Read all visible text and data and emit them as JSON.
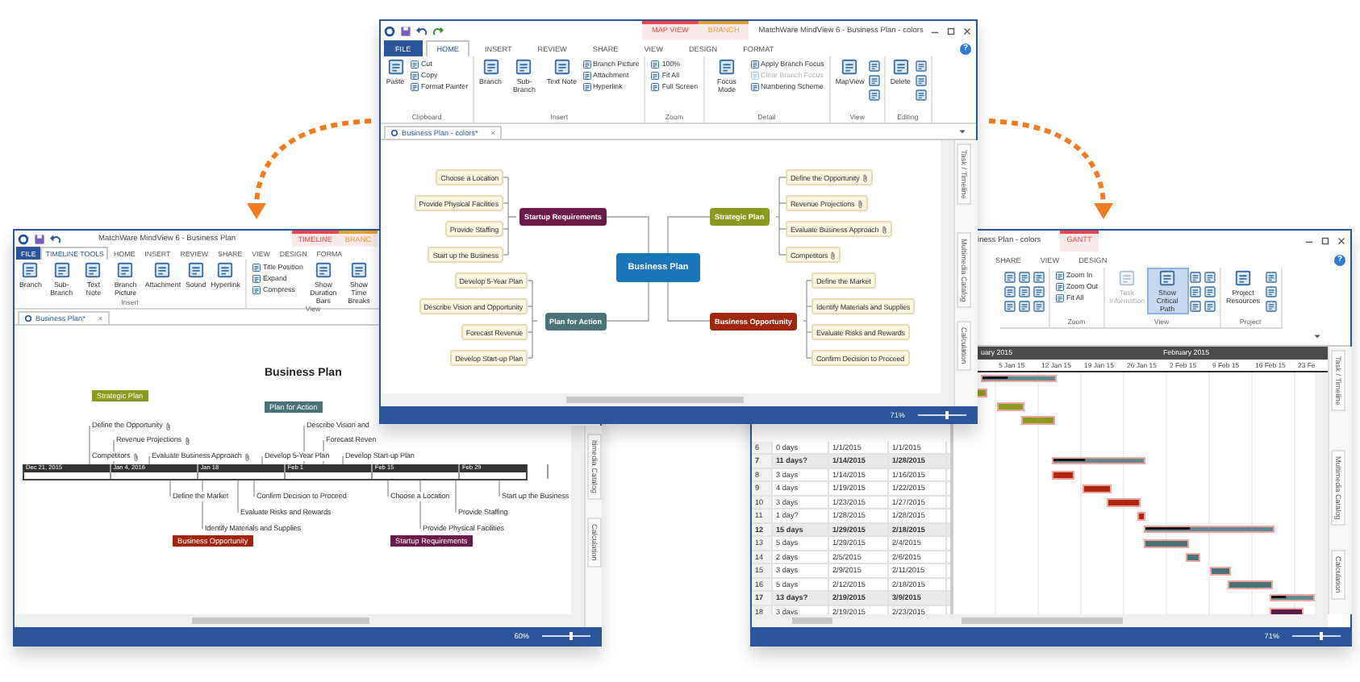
{
  "center_window": {
    "title": "MatchWare MindView 6 - Business Plan - colors",
    "context_tabs": [
      {
        "label": "MAP VIEW",
        "color": "#e8474c"
      },
      {
        "label": "BRANCH",
        "color": "#e0a030"
      }
    ],
    "tabs": [
      {
        "kind": "file",
        "label": "FILE",
        "selected": false
      },
      {
        "kind": "tab",
        "label": "HOME",
        "selected": true
      },
      {
        "kind": "tab",
        "label": "INSERT",
        "selected": false
      },
      {
        "kind": "tab",
        "label": "REVIEW",
        "selected": false
      },
      {
        "kind": "tab",
        "label": "SHARE",
        "selected": false
      },
      {
        "kind": "tab",
        "label": "VIEW",
        "selected": false
      },
      {
        "kind": "tab",
        "label": "DESIGN",
        "selected": false
      },
      {
        "kind": "tab",
        "label": "FORMAT",
        "selected": false
      }
    ],
    "help": "?",
    "ribbon": [
      {
        "label": "Clipboard",
        "items": [
          {
            "kind": "large",
            "label": "Paste",
            "disabled": false
          },
          {
            "kind": "small",
            "label": "Cut",
            "disabled": false
          },
          {
            "kind": "small",
            "label": "Copy",
            "disabled": false
          },
          {
            "kind": "small",
            "label": "Format Painter",
            "disabled": false
          }
        ]
      },
      {
        "label": "Insert",
        "items": [
          {
            "kind": "large",
            "label": "Branch",
            "disabled": false
          },
          {
            "kind": "large",
            "label": "Sub-Branch",
            "disabled": false
          },
          {
            "kind": "large",
            "label": "Text Note",
            "disabled": false
          },
          {
            "kind": "small",
            "label": "Branch Picture",
            "disabled": false
          },
          {
            "kind": "small",
            "label": "Attachment",
            "disabled": false
          },
          {
            "kind": "small",
            "label": "Hyperlink",
            "disabled": false
          }
        ]
      },
      {
        "label": "Zoom",
        "items": [
          {
            "kind": "small",
            "label": "100%",
            "disabled": false
          },
          {
            "kind": "small",
            "label": "Fit All",
            "disabled": false
          },
          {
            "kind": "small",
            "label": "Full Screen",
            "disabled": false
          }
        ]
      },
      {
        "label": "Detail",
        "items": [
          {
            "kind": "large",
            "label": "Focus Mode",
            "disabled": false
          },
          {
            "kind": "small",
            "label": "Apply Branch Focus",
            "disabled": false
          },
          {
            "kind": "small",
            "label": "Clear Branch Focus",
            "disabled": true
          },
          {
            "kind": "small",
            "label": "Numbering Scheme",
            "disabled": false
          }
        ]
      },
      {
        "label": "View",
        "items": [
          {
            "kind": "large",
            "label": "MapView",
            "disabled": false
          },
          {
            "kind": "icon",
            "disabled": false
          },
          {
            "kind": "icon",
            "disabled": false
          },
          {
            "kind": "icon",
            "disabled": false
          }
        ]
      },
      {
        "label": "Editing",
        "items": [
          {
            "kind": "large",
            "label": "Delete",
            "disabled": false
          },
          {
            "kind": "icon",
            "disabled": false
          },
          {
            "kind": "icon",
            "disabled": false
          },
          {
            "kind": "icon",
            "disabled": false
          }
        ]
      }
    ],
    "doc_tab": {
      "label": "Business Plan - colors*",
      "close": "×"
    },
    "mindmap": {
      "center": "Business Plan",
      "branches": [
        {
          "label": "Startup Requirements",
          "color": "#6b1a4a",
          "children": [
            {
              "label": "Choose a Location",
              "attachment": false
            },
            {
              "label": "Provide Physical Facilities",
              "attachment": false
            },
            {
              "label": "Provide Staffing",
              "attachment": false
            },
            {
              "label": "Start up the Business",
              "attachment": false
            }
          ]
        },
        {
          "label": "Strategic Plan",
          "color": "#8a9a1e",
          "children": [
            {
              "label": "Define the Opportunity",
              "attachment": true
            },
            {
              "label": "Revenue Projections",
              "attachment": true
            },
            {
              "label": "Evaluate Business Approach",
              "attachment": true
            },
            {
              "label": "Competitors",
              "attachment": true
            }
          ]
        },
        {
          "label": "Plan for Action",
          "color": "#4a7378",
          "children": [
            {
              "label": "Develop 5-Year  Plan",
              "attachment": false
            },
            {
              "label": "Describe Vision and Opportunity",
              "attachment": false
            },
            {
              "label": "Forecast Revenue",
              "attachment": false
            },
            {
              "label": "Develop Start-up Plan",
              "attachment": false
            }
          ]
        },
        {
          "label": "Business Opportunity",
          "color": "#a2260e",
          "children": [
            {
              "label": "Define the Market",
              "attachment": false
            },
            {
              "label": "Identify Materials and Supplies",
              "attachment": false
            },
            {
              "label": "Evaluate Risks and Rewards",
              "attachment": false
            },
            {
              "label": "Confirm Decision to Proceed",
              "attachment": false
            }
          ]
        }
      ]
    },
    "side_tabs": [
      "Task / Timeline",
      "Multimedia Catalog",
      "Calculation"
    ],
    "status": {
      "zoom": "71%",
      "level": 0.55
    }
  },
  "left_window": {
    "title": "MatchWare MindView 6 - Business Plan",
    "context_tabs": [
      {
        "label": "TIMELINE",
        "color": "#e8474c"
      },
      {
        "label": "BRANC",
        "color": "#e0a030"
      }
    ],
    "tabs": [
      {
        "kind": "file",
        "label": "FILE",
        "selected": false
      },
      {
        "kind": "tab",
        "label": "TIMELINE TOOLS",
        "selected": true
      },
      {
        "kind": "tab",
        "label": "HOME",
        "selected": false
      },
      {
        "kind": "tab",
        "label": "INSERT",
        "selected": false
      },
      {
        "kind": "tab",
        "label": "REVIEW",
        "selected": false
      },
      {
        "kind": "tab",
        "label": "SHARE",
        "selected": false
      },
      {
        "kind": "tab",
        "label": "VIEW",
        "selected": false
      },
      {
        "kind": "tab",
        "label": "DESIGN",
        "selected": false
      },
      {
        "kind": "tab",
        "label": "FORMA",
        "selected": false
      }
    ],
    "ribbon": [
      {
        "label": "Insert",
        "items": [
          {
            "kind": "large",
            "label": "Branch"
          },
          {
            "kind": "large",
            "label": "Sub-Branch"
          },
          {
            "kind": "large",
            "label": "Text Note"
          },
          {
            "kind": "large",
            "label": "Branch Picture"
          },
          {
            "kind": "large",
            "label": "Attachment"
          },
          {
            "kind": "large",
            "label": "Sound"
          },
          {
            "kind": "large",
            "label": "Hyperlink"
          }
        ]
      },
      {
        "label": "View",
        "items": [
          {
            "kind": "small",
            "label": "Title Position"
          },
          {
            "kind": "small",
            "label": "Expand"
          },
          {
            "kind": "small",
            "label": "Compress"
          },
          {
            "kind": "large",
            "label": "Show Duration Bars"
          },
          {
            "kind": "large",
            "label": "Show Time Breaks"
          }
        ]
      }
    ],
    "doc_tab": {
      "label": "Business Plan*",
      "close": "×"
    },
    "timeline": {
      "title": "Business Plan",
      "ticks": [
        "Dec 21, 2015",
        "Jan 4, 2016",
        "Jan 18",
        "Feb 1",
        "Feb 15",
        "Feb 29"
      ],
      "groups": [
        {
          "label": "Strategic Plan",
          "color": "#8a9a1e",
          "items": [
            {
              "label": "Define the Opportunity",
              "attachment": true
            },
            {
              "label": "Revenue Projections",
              "attachment": true
            },
            {
              "label": "Competitors",
              "attachment": true
            },
            {
              "label": "Evaluate Business Approach",
              "attachment": true
            }
          ]
        },
        {
          "label": "Plan for Action",
          "color": "#4a7378",
          "items": [
            {
              "label": "Describe Vision and",
              "attachment": false
            },
            {
              "label": "Forecast Reven",
              "attachment": false
            },
            {
              "label": "Develop 5-Year  Plan",
              "attachment": false
            },
            {
              "label": "Develop Start-up Plan",
              "attachment": false
            }
          ]
        },
        {
          "label": "Business Opportunity",
          "color": "#a2260e",
          "items": [
            {
              "label": "Define the Market",
              "attachment": false
            },
            {
              "label": "Confirm Decision to Proceed",
              "attachment": false
            },
            {
              "label": "Evaluate Risks and Rewards",
              "attachment": false
            },
            {
              "label": "Identify Materials and Supplies",
              "attachment": false
            }
          ]
        },
        {
          "label": "Startup Requirements",
          "color": "#6b1a4a",
          "items": [
            {
              "label": "Choose a Location",
              "attachment": false
            },
            {
              "label": "Start up the Business",
              "attachment": false
            },
            {
              "label": "Provide Staffing",
              "attachment": false
            },
            {
              "label": "Provide Physical Facilities",
              "attachment": false
            }
          ]
        }
      ]
    },
    "side_tabs": [
      "ltimedia Catalog",
      "Calculation"
    ],
    "status": {
      "zoom": "60%",
      "level": 0.55
    }
  },
  "right_window": {
    "title": "iness Plan - colors",
    "context_tabs": [
      {
        "label": "GANTT",
        "color": "#e8474c"
      }
    ],
    "tabs": [
      {
        "label": "SHARE",
        "selected": false
      },
      {
        "label": "VIEW",
        "selected": false
      },
      {
        "label": "DESIGN",
        "selected": false
      }
    ],
    "help": "?",
    "ribbon": [
      {
        "items": [
          {
            "kind": "icon",
            "disabled": false,
            "on": false
          },
          {
            "kind": "icon",
            "disabled": false,
            "on": false
          },
          {
            "kind": "icon",
            "disabled": false,
            "on": false
          },
          {
            "kind": "icon",
            "disabled": false,
            "on": false
          },
          {
            "kind": "icon",
            "disabled": false,
            "on": false
          },
          {
            "kind": "icon",
            "disabled": false,
            "on": false
          },
          {
            "kind": "icon",
            "disabled": false,
            "on": false
          },
          {
            "kind": "icon",
            "disabled": false,
            "on": false
          },
          {
            "kind": "icon",
            "disabled": false,
            "on": false
          }
        ]
      },
      {
        "label": "Zoom",
        "items": [
          {
            "kind": "small",
            "label": "Zoom In",
            "disabled": false,
            "on": false
          },
          {
            "kind": "small",
            "label": "Zoom Out",
            "disabled": false,
            "on": false
          },
          {
            "kind": "small",
            "label": "Fit All",
            "disabled": false,
            "on": false
          }
        ]
      },
      {
        "label": "View",
        "items": [
          {
            "kind": "large",
            "label": "Task Information",
            "disabled": true,
            "on": false
          },
          {
            "kind": "large",
            "label": "Show Critical Path",
            "disabled": false,
            "on": true
          },
          {
            "kind": "icon",
            "disabled": false,
            "on": false
          },
          {
            "kind": "icon",
            "disabled": false,
            "on": false
          },
          {
            "kind": "icon",
            "disabled": false,
            "on": false
          },
          {
            "kind": "icon",
            "disabled": false,
            "on": false
          },
          {
            "kind": "icon",
            "disabled": false,
            "on": false
          },
          {
            "kind": "icon",
            "disabled": false,
            "on": false
          }
        ]
      },
      {
        "label": "Project",
        "items": [
          {
            "kind": "large",
            "label": "Project Resources",
            "disabled": false,
            "on": false
          },
          {
            "kind": "icon",
            "disabled": false,
            "on": false
          },
          {
            "kind": "icon",
            "disabled": false,
            "on": false
          },
          {
            "kind": "icon",
            "disabled": false,
            "on": false
          }
        ]
      }
    ],
    "gantt": {
      "months": [
        "uary 2015",
        "February 2015"
      ],
      "weeks": [
        "5 Jan 15",
        "12 Jan 15",
        "19 Jan 15",
        "26 Jan 15",
        "2 Feb 15",
        "9 Feb 15",
        "16 Feb 15",
        "23 Fe"
      ],
      "rows": [
        {
          "number": "6",
          "duration": "0 days",
          "start": "1/1/2015",
          "finish": "1/1/2015",
          "summary": false
        },
        {
          "number": "7",
          "duration": "11 days?",
          "start": "1/14/2015",
          "finish": "1/28/2015",
          "summary": true
        },
        {
          "number": "8",
          "duration": "3 days",
          "start": "1/14/2015",
          "finish": "1/16/2015",
          "summary": false
        },
        {
          "number": "9",
          "duration": "4 days",
          "start": "1/19/2015",
          "finish": "1/22/2015",
          "summary": false
        },
        {
          "number": "10",
          "duration": "3 days",
          "start": "1/23/2015",
          "finish": "1/27/2015",
          "summary": false
        },
        {
          "number": "11",
          "duration": "1 day?",
          "start": "1/28/2015",
          "finish": "1/28/2015",
          "summary": false
        },
        {
          "number": "12",
          "duration": "15 days",
          "start": "1/29/2015",
          "finish": "2/18/2015",
          "summary": true
        },
        {
          "number": "13",
          "duration": "5 days",
          "start": "1/29/2015",
          "finish": "2/4/2015",
          "summary": false
        },
        {
          "number": "14",
          "duration": "2 days",
          "start": "2/5/2015",
          "finish": "2/6/2015",
          "summary": false
        },
        {
          "number": "15",
          "duration": "3 days",
          "start": "2/9/2015",
          "finish": "2/11/2015",
          "summary": false
        },
        {
          "number": "16",
          "duration": "5 days",
          "start": "2/12/2015",
          "finish": "2/18/2015",
          "summary": false
        },
        {
          "number": "17",
          "duration": "13 days?",
          "start": "2/19/2015",
          "finish": "3/9/2015",
          "summary": true
        },
        {
          "number": "18",
          "duration": "3 days",
          "start": "2/19/2015",
          "finish": "2/23/2015",
          "summary": false
        }
      ]
    },
    "side_tabs": [
      "Task / Timeline",
      "Multimedia Catalog",
      "Calculation"
    ],
    "status": {
      "zoom": "71%",
      "level": 0.55
    }
  }
}
